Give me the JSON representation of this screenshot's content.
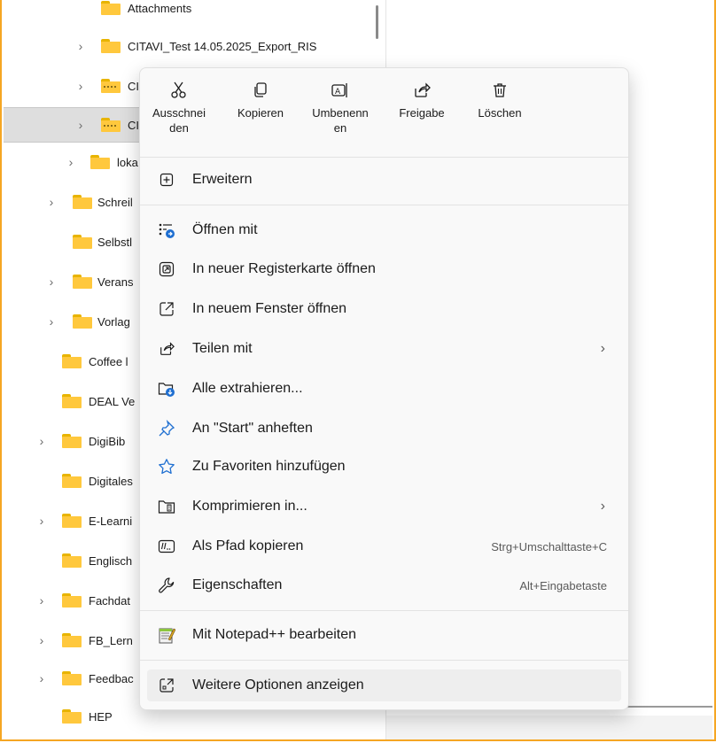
{
  "tree": {
    "items": [
      {
        "label": "Attachments",
        "has_chevron": false,
        "zip": false
      },
      {
        "label": "CITAVI_Test 14.05.2025_Export_RIS",
        "has_chevron": true,
        "zip": false
      },
      {
        "label": "CI",
        "has_chevron": true,
        "zip": true
      },
      {
        "label": "CI",
        "has_chevron": true,
        "zip": true,
        "selected": true
      },
      {
        "label": "loka",
        "has_chevron": true,
        "zip": false
      },
      {
        "label": "Schreil",
        "has_chevron": true,
        "zip": false
      },
      {
        "label": "Selbstl",
        "has_chevron": false,
        "zip": false
      },
      {
        "label": "Verans",
        "has_chevron": true,
        "zip": false
      },
      {
        "label": "Vorlag",
        "has_chevron": true,
        "zip": false
      },
      {
        "label": "Coffee l",
        "has_chevron": false,
        "zip": false
      },
      {
        "label": "DEAL Ve",
        "has_chevron": false,
        "zip": false
      },
      {
        "label": "DigiBib",
        "has_chevron": true,
        "zip": false
      },
      {
        "label": "Digitales",
        "has_chevron": false,
        "zip": false
      },
      {
        "label": "E-Learni",
        "has_chevron": true,
        "zip": false
      },
      {
        "label": "Englisch",
        "has_chevron": false,
        "zip": false
      },
      {
        "label": "Fachdat",
        "has_chevron": true,
        "zip": false
      },
      {
        "label": "FB_Lern",
        "has_chevron": true,
        "zip": false
      },
      {
        "label": "Feedbac",
        "has_chevron": true,
        "zip": false
      },
      {
        "label": "HEP",
        "has_chevron": false,
        "zip": false
      }
    ]
  },
  "menu": {
    "top_actions": [
      {
        "label": "Ausschnei den",
        "line1": "Ausschnei",
        "line2": "den",
        "icon": "scissors-icon"
      },
      {
        "label": "Kopieren",
        "line1": "Kopieren",
        "line2": "",
        "icon": "copy-icon"
      },
      {
        "label": "Umbenennen",
        "line1": "Umbenenn",
        "line2": "en",
        "icon": "rename-icon"
      },
      {
        "label": "Freigabe",
        "line1": "Freigabe",
        "line2": "",
        "icon": "share-icon"
      },
      {
        "label": "Löschen",
        "line1": "Löschen",
        "line2": "",
        "icon": "trash-icon"
      }
    ],
    "items": [
      {
        "label": "Erweitern",
        "icon": "expand-plus-icon",
        "accel": "",
        "submenu": false
      },
      {
        "label": "Öffnen mit",
        "icon": "open-with-icon",
        "accel": "",
        "submenu": false
      },
      {
        "label": "In neuer Registerkarte öffnen",
        "icon": "new-tab-icon",
        "accel": "",
        "submenu": false
      },
      {
        "label": "In neuem Fenster öffnen",
        "icon": "new-window-icon",
        "accel": "",
        "submenu": false
      },
      {
        "label": "Teilen mit",
        "icon": "share-with-icon",
        "accel": "",
        "submenu": true
      },
      {
        "label": "Alle extrahieren...",
        "icon": "extract-icon",
        "accel": "",
        "submenu": false
      },
      {
        "label": "An \"Start\" anheften",
        "icon": "pin-icon",
        "accel": "",
        "submenu": false
      },
      {
        "label": "Zu Favoriten hinzufügen",
        "icon": "star-icon",
        "accel": "",
        "submenu": false
      },
      {
        "label": "Komprimieren in...",
        "icon": "compress-icon",
        "accel": "",
        "submenu": true
      },
      {
        "label": "Als Pfad kopieren",
        "icon": "copy-path-icon",
        "accel": "Strg+Umschalttaste+C",
        "submenu": false
      },
      {
        "label": "Eigenschaften",
        "icon": "wrench-icon",
        "accel": "Alt+Eingabetaste",
        "submenu": false
      },
      {
        "label": "Mit Notepad++ bearbeiten",
        "icon": "notepadpp-icon",
        "accel": "",
        "submenu": false
      },
      {
        "label": "Weitere Optionen anzeigen",
        "icon": "more-options-icon",
        "accel": "",
        "submenu": false
      }
    ]
  },
  "colors": {
    "frame_border": "#f5a623",
    "folder": "#ffc83d",
    "accent_blue": "#1f6fd1",
    "selection": "#dedede"
  }
}
